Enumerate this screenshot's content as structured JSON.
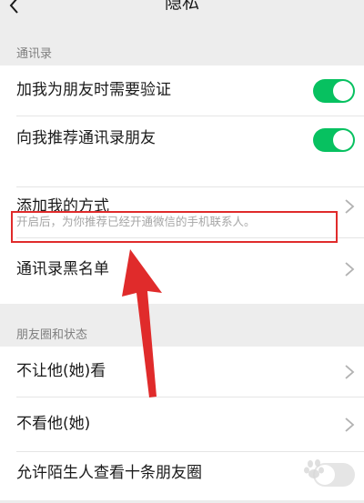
{
  "header": {
    "title": "隐私",
    "back_icon": "chevron-left-icon"
  },
  "contacts_section": {
    "label": "通讯录",
    "items": [
      {
        "label": "加我为朋友时需要验证",
        "control": "toggle",
        "enabled": true
      },
      {
        "label": "向我推荐通讯录朋友",
        "control": "toggle",
        "enabled": true,
        "hint": "开启后，为你推荐已经开通微信的手机联系人。"
      },
      {
        "label": "添加我的方式",
        "control": "chevron",
        "highlighted": true
      },
      {
        "label": "通讯录黑名单",
        "control": "chevron"
      }
    ]
  },
  "moments_section": {
    "label": "朋友圈和状态",
    "items": [
      {
        "label": "不让他(她)看",
        "control": "chevron"
      },
      {
        "label": "不看他(她)",
        "control": "chevron"
      },
      {
        "label": "允许陌生人查看十条朋友圈",
        "control": "toggle"
      }
    ]
  },
  "annotation": {
    "box_color": "#e02b2b",
    "arrow_color": "#e02b2b"
  },
  "colors": {
    "toggle_on": "#07c160",
    "background": "#ededed",
    "row_background": "#ffffff"
  },
  "watermark": {
    "brand": "Baidu",
    "icon": "baidu-paw-icon"
  }
}
